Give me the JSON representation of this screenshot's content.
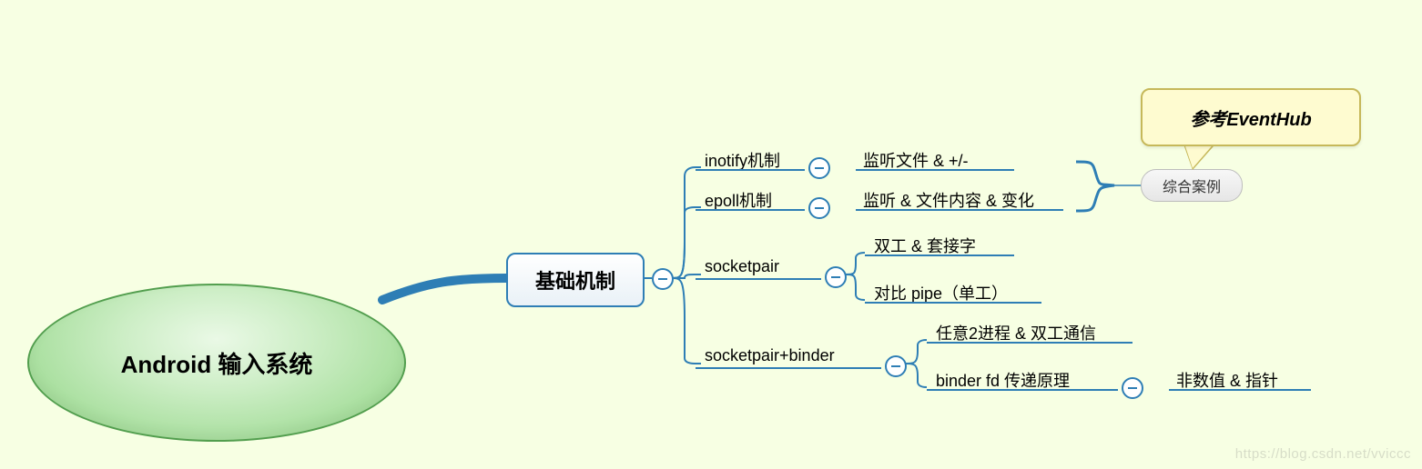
{
  "root": {
    "title": "Android 输入系统"
  },
  "level1": {
    "title": "基础机制"
  },
  "nodes": {
    "inotify": {
      "label": "inotify机制",
      "detail": "监听文件 & +/-"
    },
    "epoll": {
      "label": "epoll机制",
      "detail": "监听 & 文件内容 & 变化"
    },
    "socketpair": {
      "label": "socketpair",
      "sub1": "双工 & 套接字",
      "sub2": "对比 pipe（单工）"
    },
    "socketpair_binder": {
      "label": "socketpair+binder",
      "sub1": "任意2进程 & 双工通信",
      "sub2": "binder fd 传递原理",
      "sub2_detail": "非数值 & 指针"
    }
  },
  "case": {
    "label": "综合案例"
  },
  "callout": {
    "text": "参考EventHub"
  },
  "watermark": "https://blog.csdn.net/vviccc"
}
